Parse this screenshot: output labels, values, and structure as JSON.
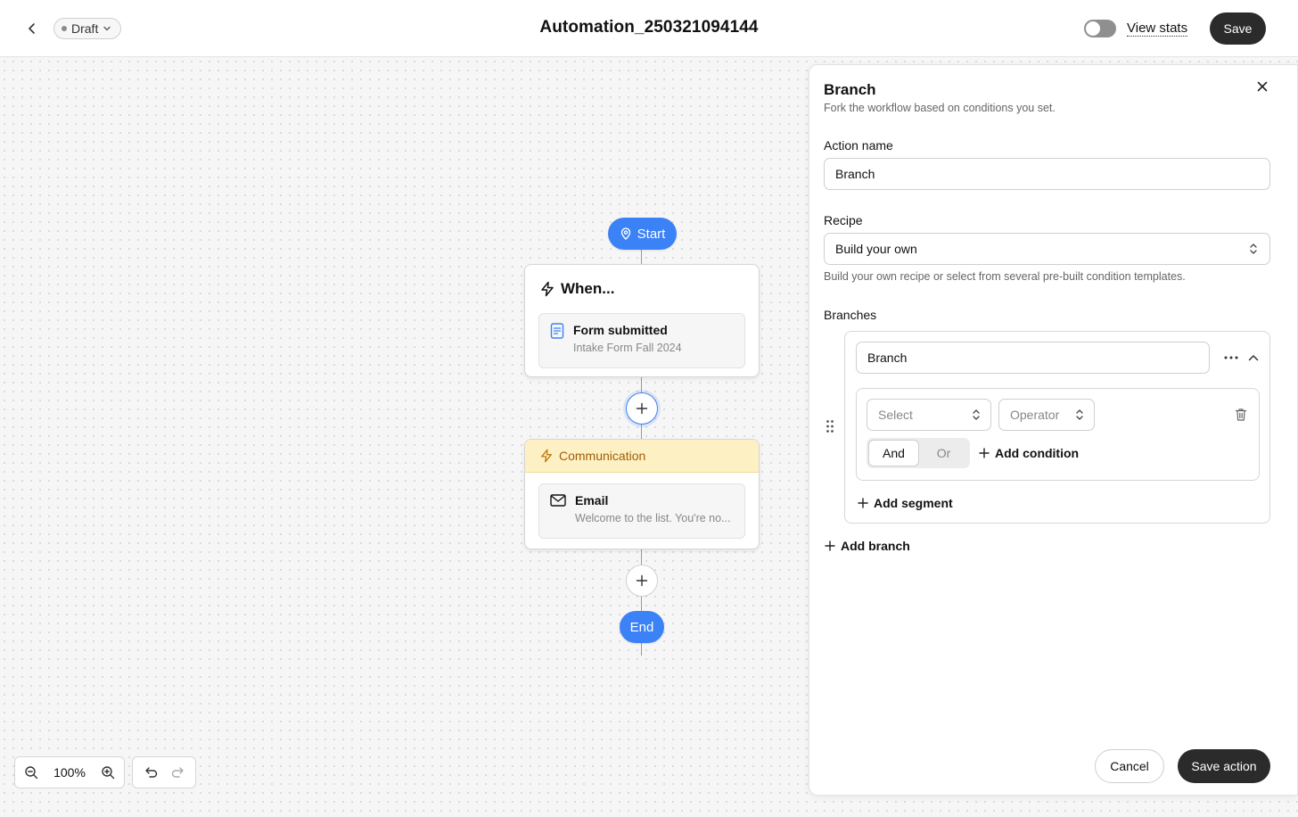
{
  "header": {
    "status_label": "Draft",
    "title": "Automation_250321094144",
    "view_stats_label": "View stats",
    "save_label": "Save",
    "stats_toggle_on": false
  },
  "flow": {
    "start_label": "Start",
    "trigger_card": {
      "heading": "When...",
      "item_title": "Form submitted",
      "item_subtitle": "Intake Form Fall 2024"
    },
    "action_card": {
      "category": "Communication",
      "item_title": "Email",
      "item_subtitle": "Welcome to the list. You're no..."
    },
    "end_label": "End"
  },
  "canvas_controls": {
    "zoom_level": "100%"
  },
  "panel": {
    "title": "Branch",
    "subtitle": "Fork the workflow based on conditions you set.",
    "action_name_label": "Action name",
    "action_name_value": "Branch",
    "recipe_label": "Recipe",
    "recipe_value": "Build your own",
    "recipe_helper": "Build your own recipe or select from several pre-built condition templates.",
    "branches_label": "Branches",
    "branch": {
      "name_value": "Branch",
      "select_placeholder": "Select",
      "operator_placeholder": "Operator",
      "logic_options": [
        "And",
        "Or"
      ],
      "logic_selected": "And",
      "add_condition_label": "Add condition",
      "add_segment_label": "Add segment"
    },
    "add_branch_label": "Add branch",
    "cancel_label": "Cancel",
    "save_action_label": "Save action"
  },
  "colors": {
    "accent_blue": "#3b82f6",
    "communication_bg": "#fdf1c4",
    "communication_text": "#a15c07",
    "dark_button": "#2b2b2b"
  }
}
